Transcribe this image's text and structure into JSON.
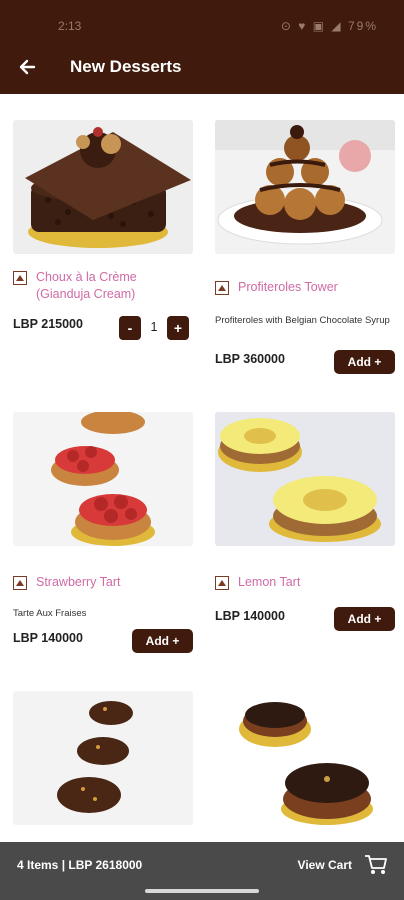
{
  "status_bar": {
    "time": "2:13",
    "icons": "⊙ ♥ ▣ ◢ 79%"
  },
  "header": {
    "title": "New Desserts"
  },
  "products": [
    {
      "title": "Choux à la Crème (Gianduja Cream)",
      "description": "",
      "price": "LBP 215000",
      "quantity": "1"
    },
    {
      "title": "Profiteroles Tower",
      "description": "Profiteroles with Belgian Chocolate Syrup",
      "price": "LBP 360000",
      "add_label": "Add +"
    },
    {
      "title": "Strawberry Tart",
      "description": "Tarte Aux Fraises",
      "price": "LBP 140000",
      "add_label": "Add +"
    },
    {
      "title": "Lemon Tart",
      "description": "",
      "price": "LBP 140000",
      "add_label": "Add +"
    }
  ],
  "stepper": {
    "minus": "-",
    "plus": "+"
  },
  "cart_bar": {
    "summary": "4 Items | LBP 2618000",
    "view_label": "View Cart"
  },
  "colors": {
    "brand_dark_brown": "#3f1a0d",
    "title_pink": "#d06aa5",
    "cart_bar_gray": "#4a4a4a"
  },
  "icons": [
    "back-arrow-icon",
    "veg-indicator-icon",
    "cart-icon"
  ]
}
